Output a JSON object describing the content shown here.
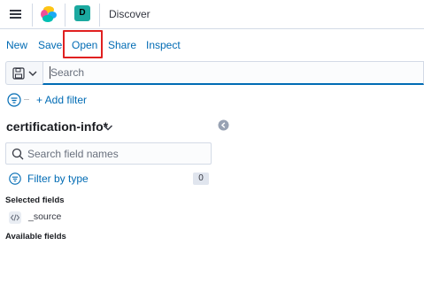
{
  "header": {
    "space_initial": "D",
    "app_title": "Discover",
    "logo_colors": [
      "#f04e98",
      "#fec514",
      "#00bfb3",
      "#1ba9f5"
    ],
    "space_color": "#1ba9a0"
  },
  "topnav": {
    "items": [
      {
        "label": "New"
      },
      {
        "label": "Save"
      },
      {
        "label": "Open"
      },
      {
        "label": "Share"
      },
      {
        "label": "Inspect"
      }
    ],
    "highlighted": "Open",
    "highlight_color": "#e02020"
  },
  "query": {
    "search_placeholder": "Search",
    "search_value": ""
  },
  "filters": {
    "add_filter_label": "+ Add filter"
  },
  "sidebar": {
    "index_pattern": "certification-info*",
    "field_search_placeholder": "Search field names",
    "filter_by_type_label": "Filter by type",
    "filter_count": "0",
    "selected_fields_heading": "Selected fields",
    "selected_fields": [
      {
        "name": "_source",
        "icon": "code-icon"
      }
    ],
    "available_fields_heading": "Available fields"
  },
  "colors": {
    "link": "#006bb4",
    "text": "#343741",
    "border": "#d3dae6"
  }
}
